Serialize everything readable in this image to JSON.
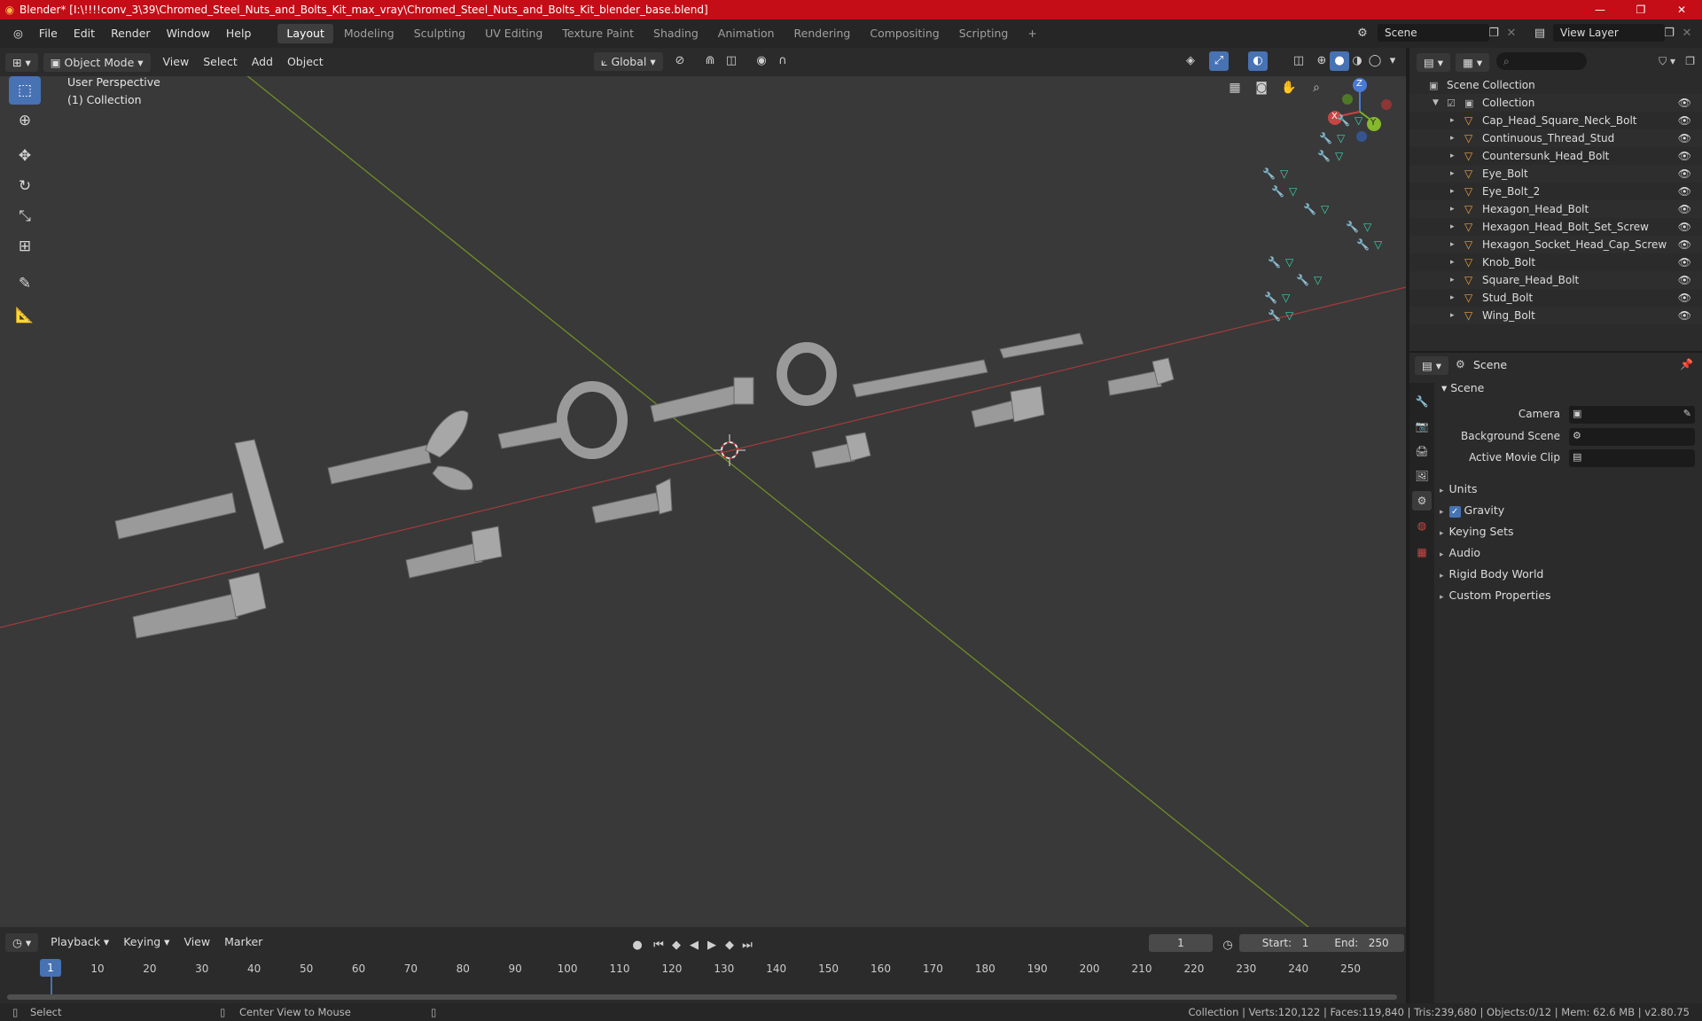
{
  "window": {
    "title": "Blender* [I:\\!!!!conv_3\\39\\Chromed_Steel_Nuts_and_Bolts_Kit_max_vray\\Chromed_Steel_Nuts_and_Bolts_Kit_blender_base.blend]",
    "accent": "#c40d17"
  },
  "menus": [
    "File",
    "Edit",
    "Render",
    "Window",
    "Help"
  ],
  "workspaces": [
    "Layout",
    "Modeling",
    "Sculpting",
    "UV Editing",
    "Texture Paint",
    "Shading",
    "Animation",
    "Rendering",
    "Compositing",
    "Scripting"
  ],
  "active_workspace": "Layout",
  "scene_field": "Scene",
  "view_layer_field": "View Layer",
  "viewport": {
    "mode": "Object Mode",
    "menus": [
      "View",
      "Select",
      "Add",
      "Object"
    ],
    "transform": "Global",
    "perspective_label": "User Perspective",
    "collection_label": "(1) Collection",
    "gizmo": {
      "x": "X",
      "y": "Y",
      "z": "Z"
    }
  },
  "outliner": {
    "scene_collection": "Scene Collection",
    "collection": "Collection",
    "objects": [
      "Cap_Head_Square_Neck_Bolt",
      "Continuous_Thread_Stud",
      "Countersunk_Head_Bolt",
      "Eye_Bolt",
      "Eye_Bolt_2",
      "Hexagon_Head_Bolt",
      "Hexagon_Head_Bolt_Set_Screw",
      "Hexagon_Socket_Head_Cap_Screw",
      "Knob_Bolt",
      "Square_Head_Bolt",
      "Stud_Bolt",
      "Wing_Bolt"
    ]
  },
  "properties": {
    "header": "Scene",
    "panel": "Scene",
    "camera_label": "Camera",
    "background_label": "Background Scene",
    "clip_label": "Active Movie Clip",
    "sections": [
      "Units",
      "Gravity",
      "Keying Sets",
      "Audio",
      "Rigid Body World",
      "Custom Properties"
    ]
  },
  "timeline": {
    "menus": [
      "Playback",
      "Keying",
      "View",
      "Marker"
    ],
    "current_frame": "1",
    "start_label": "Start:",
    "start": "1",
    "end_label": "End:",
    "end": "250",
    "ticks": [
      "10",
      "20",
      "30",
      "40",
      "50",
      "60",
      "70",
      "80",
      "90",
      "100",
      "110",
      "120",
      "130",
      "140",
      "150",
      "160",
      "170",
      "180",
      "190",
      "200",
      "210",
      "220",
      "230",
      "240",
      "250"
    ]
  },
  "status": {
    "left": "Select",
    "middle": "Center View to Mouse",
    "right": "Collection | Verts:120,122 | Faces:119,840 | Tris:239,680 | Objects:0/12 | Mem: 62.6 MB | v2.80.75"
  }
}
